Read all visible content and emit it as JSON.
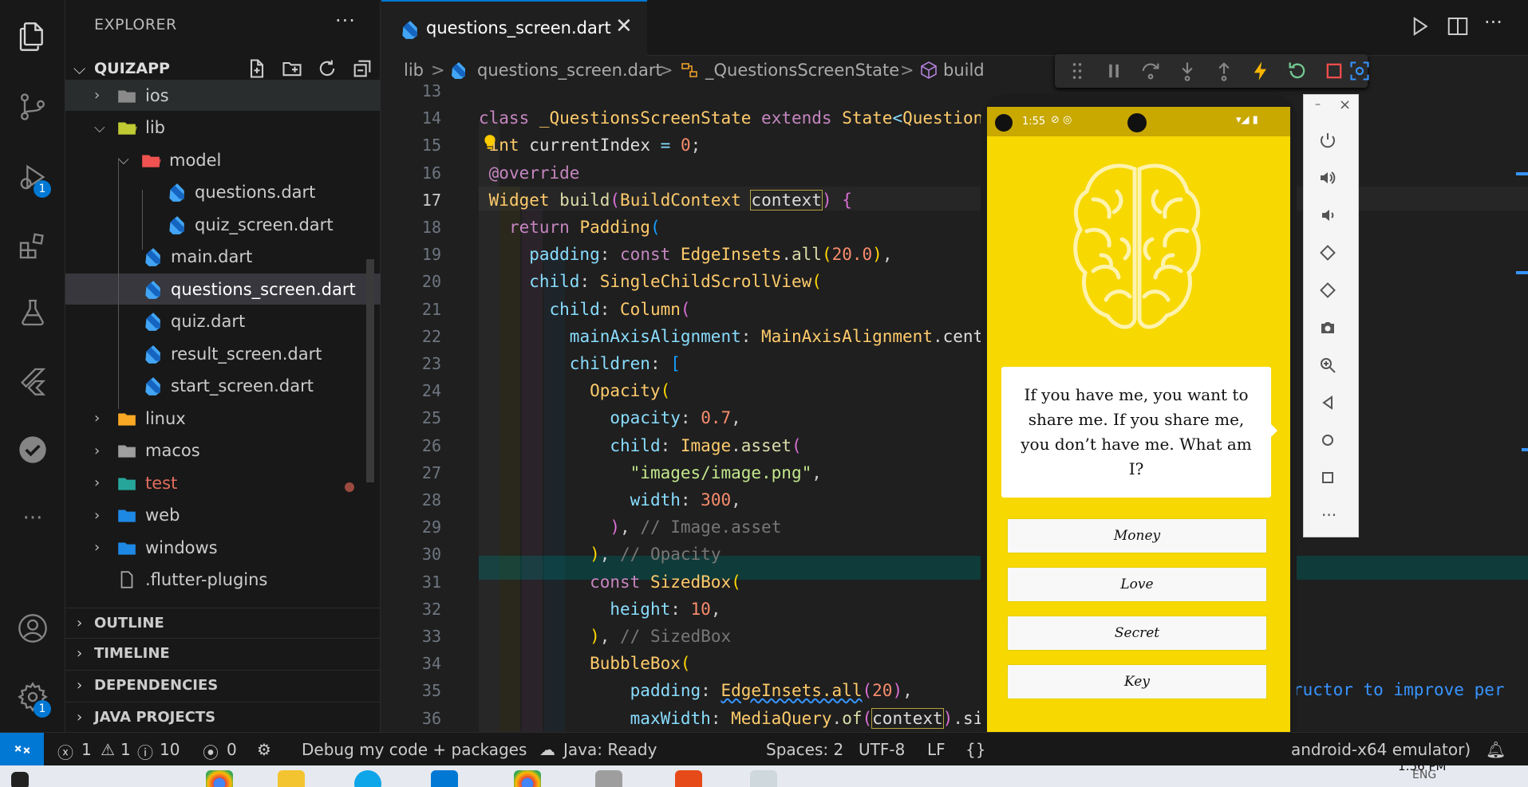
{
  "activity": {
    "debug_badge": "1",
    "settings_badge": "1"
  },
  "explorer": {
    "title": "EXPLORER",
    "more": "···",
    "project": "QUIZAPP"
  },
  "tree": [
    {
      "label": "ios",
      "kind": "folder",
      "color": "#8a8a8a"
    },
    {
      "label": "lib",
      "kind": "folder-open",
      "color": "#c0ca33"
    },
    {
      "label": "model",
      "kind": "folder-open",
      "color": "#ef5350"
    },
    {
      "label": "questions.dart",
      "kind": "dart"
    },
    {
      "label": "quiz_screen.dart",
      "kind": "dart"
    },
    {
      "label": "main.dart",
      "kind": "dart"
    },
    {
      "label": "questions_screen.dart",
      "kind": "dart"
    },
    {
      "label": "quiz.dart",
      "kind": "dart"
    },
    {
      "label": "result_screen.dart",
      "kind": "dart"
    },
    {
      "label": "start_screen.dart",
      "kind": "dart"
    },
    {
      "label": "linux",
      "kind": "folder",
      "color": "#f9a825"
    },
    {
      "label": "macos",
      "kind": "folder",
      "color": "#9e9e9e"
    },
    {
      "label": "test",
      "kind": "folder",
      "color": "#26a69a",
      "modified": true
    },
    {
      "label": "web",
      "kind": "folder",
      "color": "#1e88e5"
    },
    {
      "label": "windows",
      "kind": "folder",
      "color": "#1e88e5"
    },
    {
      "label": ".flutter-plugins",
      "kind": "file"
    }
  ],
  "sections": [
    "OUTLINE",
    "TIMELINE",
    "DEPENDENCIES",
    "JAVA PROJECTS"
  ],
  "tab": {
    "label": "questions_screen.dart",
    "close": "✕"
  },
  "breadcrumb": [
    "lib",
    ">",
    "questions_screen.dart",
    ">",
    "_QuestionsScreenState",
    ">",
    "build"
  ],
  "code": {
    "line_numbers": [
      "13",
      "14",
      "15",
      "16",
      "17",
      "18",
      "19",
      "20",
      "21",
      "22",
      "23",
      "24",
      "25",
      "26",
      "27",
      "28",
      "29",
      "30",
      "31",
      "32",
      "33",
      "34",
      "35",
      "36"
    ],
    "current_line": "17",
    "inlay": "ructor to improve per"
  },
  "phone": {
    "time": "1:55",
    "question": "If you have me, you want to share me. If you share me, you don’t have me. What am I?",
    "answers": [
      "Money",
      "Love",
      "Secret",
      "Key"
    ]
  },
  "emulator": {
    "close": "×",
    "min": "–"
  },
  "status": {
    "errors": "1",
    "warnings": "1",
    "info": "10",
    "ports": "0",
    "debug": "Debug my code + packages",
    "java": "Java: Ready",
    "spaces": "Spaces: 2",
    "encoding": "UTF-8",
    "eol": "LF",
    "brace": "{}",
    "emulator": "android-x64 emulator)"
  },
  "taskbar": {
    "time": "1:56 PM",
    "lang": "ENG"
  }
}
